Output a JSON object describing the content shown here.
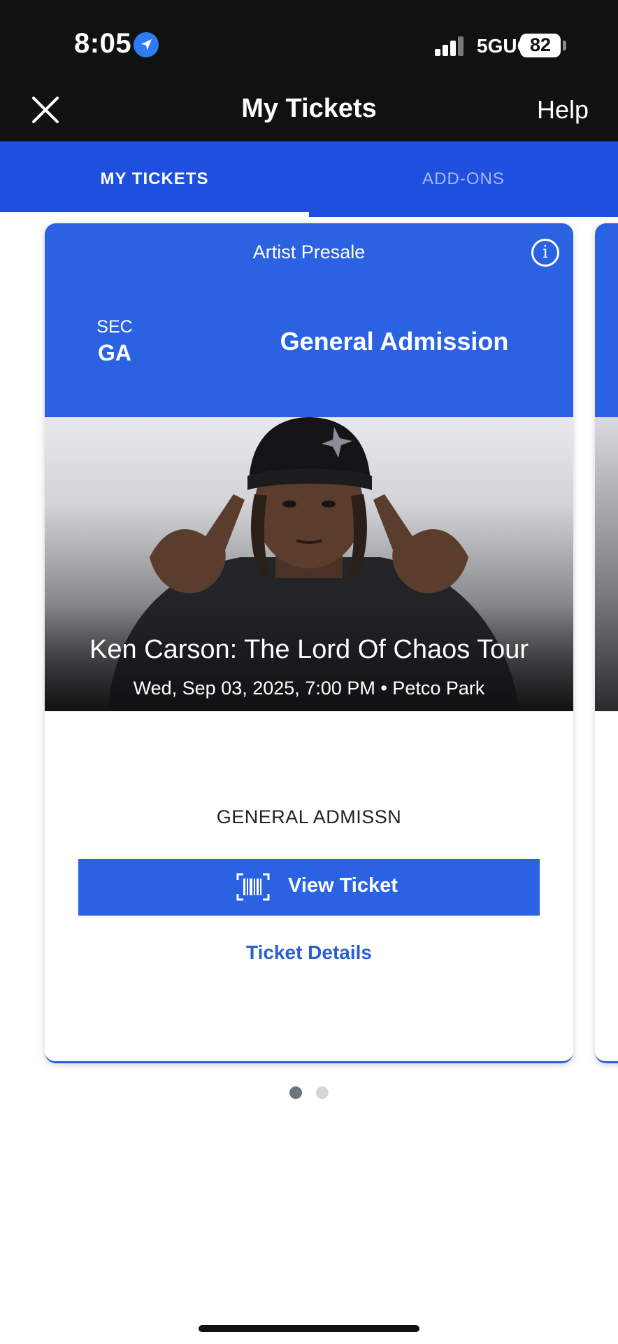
{
  "status_bar": {
    "time": "8:05",
    "network": "5GUC",
    "battery": "82"
  },
  "header": {
    "title": "My Tickets",
    "help": "Help"
  },
  "tabs": [
    {
      "label": "MY TICKETS",
      "active": true
    },
    {
      "label": "ADD-ONS",
      "active": false
    }
  ],
  "ticket": {
    "presale_label": "Artist Presale",
    "section_label": "SEC",
    "section_value": "GA",
    "admission": "General Admission",
    "event_title": "Ken Carson: The Lord Of Chaos Tour",
    "event_meta": "Wed, Sep 03, 2025, 7:00 PM • Petco Park",
    "ticket_type": "GENERAL ADMISSN",
    "view_button": "View Ticket",
    "details_link": "Ticket Details"
  },
  "pager": {
    "count": 2,
    "active_index": 0
  },
  "colors": {
    "brand_blue": "#2a62e2",
    "tab_bar": "#1f4fdf",
    "link_blue": "#2a5fd4",
    "status_bar": "#111111"
  }
}
